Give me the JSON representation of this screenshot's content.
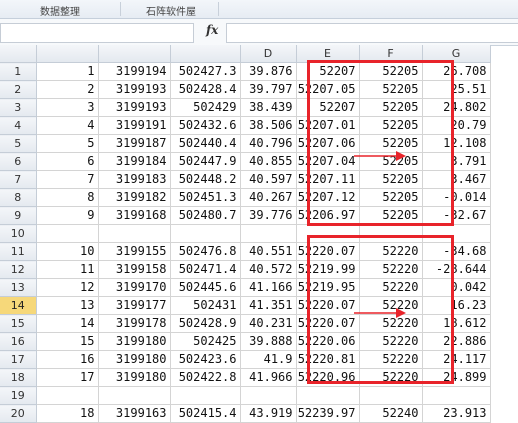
{
  "ribbon": {
    "items": [
      "数据整理",
      "石阵软件屋"
    ]
  },
  "formula_bar": {
    "fx": "fx",
    "value": ""
  },
  "columns": [
    "",
    "",
    "",
    "D",
    "E",
    "F",
    "G"
  ],
  "rows": [
    {
      "rownum": "1",
      "cells": [
        "1",
        "3199194",
        "502427.3",
        "39.876",
        "52207",
        "52205",
        "26.708"
      ]
    },
    {
      "rownum": "2",
      "cells": [
        "2",
        "3199193",
        "502428.4",
        "39.797",
        "52207.05",
        "52205",
        "25.51"
      ]
    },
    {
      "rownum": "3",
      "cells": [
        "3",
        "3199193",
        "502429",
        "38.439",
        "52207",
        "52205",
        "24.802"
      ]
    },
    {
      "rownum": "4",
      "cells": [
        "4",
        "3199191",
        "502432.6",
        "38.506",
        "52207.01",
        "52205",
        "20.79"
      ]
    },
    {
      "rownum": "5",
      "cells": [
        "5",
        "3199187",
        "502440.4",
        "40.796",
        "52207.06",
        "52205",
        "12.108"
      ]
    },
    {
      "rownum": "6",
      "cells": [
        "6",
        "3199184",
        "502447.9",
        "40.855",
        "52207.04",
        "52205",
        "3.791"
      ]
    },
    {
      "rownum": "7",
      "cells": [
        "7",
        "3199183",
        "502448.2",
        "40.597",
        "52207.11",
        "52205",
        "3.467"
      ]
    },
    {
      "rownum": "8",
      "cells": [
        "8",
        "3199182",
        "502451.3",
        "40.267",
        "52207.12",
        "52205",
        "-0.014"
      ]
    },
    {
      "rownum": "9",
      "cells": [
        "9",
        "3199168",
        "502480.7",
        "39.776",
        "52206.97",
        "52205",
        "-32.67"
      ]
    },
    {
      "rownum": "10",
      "cells": [
        "",
        "",
        "",
        "",
        "",
        "",
        ""
      ]
    },
    {
      "rownum": "11",
      "cells": [
        "10",
        "3199155",
        "502476.8",
        "40.551",
        "52220.07",
        "52220",
        "-34.68"
      ]
    },
    {
      "rownum": "12",
      "cells": [
        "11",
        "3199158",
        "502471.4",
        "40.572",
        "52219.99",
        "52220",
        "-28.644"
      ]
    },
    {
      "rownum": "13",
      "cells": [
        "12",
        "3199170",
        "502445.6",
        "41.166",
        "52219.95",
        "52220",
        "0.042"
      ]
    },
    {
      "rownum": "14",
      "cells": [
        "13",
        "3199177",
        "502431",
        "41.351",
        "52220.07",
        "52220",
        "16.23"
      ]
    },
    {
      "rownum": "15",
      "cells": [
        "14",
        "3199178",
        "502428.9",
        "40.231",
        "52220.07",
        "52220",
        "18.612"
      ]
    },
    {
      "rownum": "16",
      "cells": [
        "15",
        "3199180",
        "502425",
        "39.888",
        "52220.06",
        "52220",
        "22.886"
      ]
    },
    {
      "rownum": "17",
      "cells": [
        "16",
        "3199180",
        "502423.6",
        "41.9",
        "52220.81",
        "52220",
        "24.117"
      ]
    },
    {
      "rownum": "18",
      "cells": [
        "17",
        "3199180",
        "502422.8",
        "41.966",
        "52220.96",
        "52220",
        "24.899"
      ]
    },
    {
      "rownum": "19",
      "cells": [
        "",
        "",
        "",
        "",
        "",
        "",
        ""
      ]
    },
    {
      "rownum": "20",
      "cells": [
        "18",
        "3199163",
        "502415.4",
        "43.919",
        "52239.97",
        "52240",
        "23.913"
      ]
    }
  ],
  "active_row": "14",
  "highlight_color": "#e8232a"
}
